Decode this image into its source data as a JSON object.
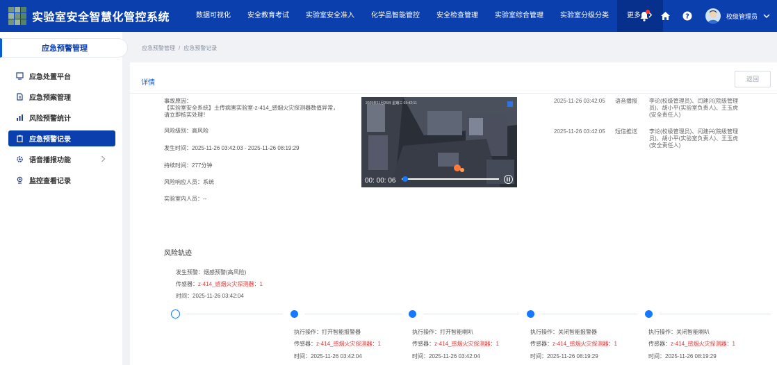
{
  "app": {
    "title": "实验室安全智慧化管控系统",
    "user_name": "校级管理员",
    "colors": {
      "primary": "#0b3fae",
      "accent": "#1677ff",
      "danger": "#e03a3a"
    }
  },
  "nav": {
    "items": [
      "数据可视化",
      "安全教育考试",
      "实验室安全准入",
      "化学品智能管控",
      "安全检查管理",
      "实验室综合管理",
      "实验室分级分类"
    ],
    "more": "更多"
  },
  "sidebar": {
    "header": "应急预警管理",
    "items": [
      {
        "label": "应急处置平台",
        "icon": "monitor-icon"
      },
      {
        "label": "应急预案管理",
        "icon": "document-icon"
      },
      {
        "label": "风险预警统计",
        "icon": "bar-chart-icon"
      },
      {
        "label": "应急预警记录",
        "icon": "clipboard-icon"
      },
      {
        "label": "语音播报功能",
        "icon": "gear-icon"
      },
      {
        "label": "监控查看记录",
        "icon": "camera-icon"
      }
    ]
  },
  "breadcrumb": {
    "parent": "应急预警管理",
    "sep": "/",
    "current": "应急预警记录"
  },
  "detail": {
    "title": "详情",
    "back_label": "返回",
    "reason_label": "事故原因：",
    "reason_text": "【实验室安全系统】土传病害实验室-z-414_感烟火灾探测器数值异常，请立即核实处理！",
    "level": "风险级别：高风险",
    "time": "发生时间：2025-11-26 03:42:03 - 2025-11-26 08:19:29",
    "duration": "持续时间：277分钟",
    "responder": "风险响应人员：系统",
    "people_inside": "实验室内人员：--"
  },
  "video": {
    "osd": "2025年11月26日 星期三 03:42:11",
    "current_time": "00: 00: 06",
    "progress": 0.02
  },
  "notices": [
    {
      "time": "2025-11-26 03:42:05",
      "type": "语音播报",
      "people": "李论(校级管理员)、闫建兴(院级管理员)、胡小平(实验室负责人)、王玉虎(安全责任人)"
    },
    {
      "time": "2025-11-26 03:42:05",
      "type": "短信推送",
      "people": "李论(校级管理员)、闫建兴(院级管理员)、胡小平(实验室负责人)、王玉虎(安全责任人)"
    }
  ],
  "track": {
    "title": "风险轨迹",
    "origin": {
      "warning": "发生预警：烟感预警(高风险)",
      "sensor_label": "传感器：",
      "sensor": "z-414_感烟火灾探测器：1",
      "time": "时间：2025-11-26 03:42:04"
    },
    "steps": [
      {
        "action": "执行操作：打开智能报警器",
        "sensor_label": "传感器：",
        "sensor": "z-414_感烟火灾探测器：1",
        "time": "时间：2025-11-26 03:42:04"
      },
      {
        "action": "执行操作：打开智能喇叭",
        "sensor_label": "传感器：",
        "sensor": "z-414_感烟火灾探测器：1",
        "time": "时间：2025-11-26 03:42:04"
      },
      {
        "action": "执行操作：关闭智能报警器",
        "sensor_label": "传感器：",
        "sensor": "z-414_感烟火灾探测器：1",
        "time": "时间：2025-11-26 08:19:29"
      },
      {
        "action": "执行操作：关闭智能喇叭",
        "sensor_label": "传感器：",
        "sensor": "z-414_感烟火灾探测器：1",
        "time": "时间：2025-11-26 08:19:29"
      }
    ]
  }
}
